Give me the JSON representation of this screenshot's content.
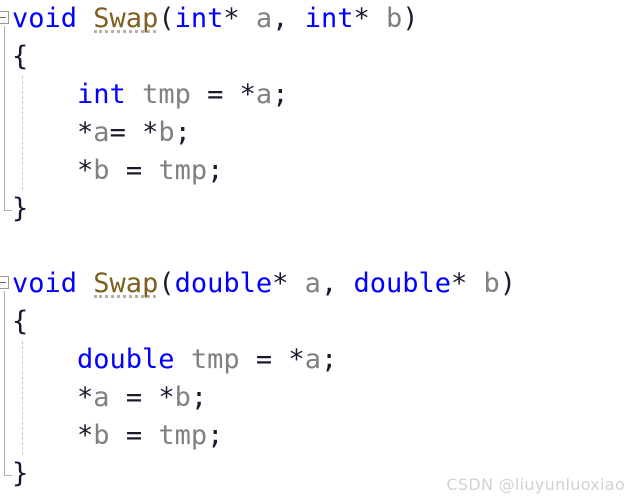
{
  "editor": {
    "background_color": "#ffffff",
    "font_size_px": 27,
    "line_height_px": 38,
    "language": "C",
    "colors": {
      "keyword": "#0000ff",
      "function_name": "#7d6020",
      "identifier": "#808080",
      "punctuation": "#1a1a2e",
      "brace": "#16163a",
      "fold_marker": "#9a9a9a",
      "indent_guide": "#c8c8c8",
      "watermark": "#d2d2d2"
    }
  },
  "blocks": [
    {
      "id": "swap-int",
      "fold_state": "expanded",
      "fold_glyph": "minus",
      "lines": [
        {
          "id": "line-1",
          "text": "void Swap(int* a, int* b)",
          "tokens": [
            {
              "t": "void",
              "k": "keyword"
            },
            {
              "t": " ",
              "k": "plain"
            },
            {
              "t": "Swap",
              "k": "function"
            },
            {
              "t": "(",
              "k": "punct"
            },
            {
              "t": "int",
              "k": "keyword"
            },
            {
              "t": "*",
              "k": "op"
            },
            {
              "t": " ",
              "k": "plain"
            },
            {
              "t": "a",
              "k": "ident"
            },
            {
              "t": ", ",
              "k": "punct"
            },
            {
              "t": "int",
              "k": "keyword"
            },
            {
              "t": "*",
              "k": "op"
            },
            {
              "t": " ",
              "k": "plain"
            },
            {
              "t": "b",
              "k": "ident"
            },
            {
              "t": ")",
              "k": "punct"
            }
          ]
        },
        {
          "id": "line-2",
          "text": "{",
          "tokens": [
            {
              "t": "{",
              "k": "brace"
            }
          ]
        },
        {
          "id": "line-3",
          "text": "    int tmp = *a;",
          "tokens": [
            {
              "t": "    ",
              "k": "plain"
            },
            {
              "t": "int",
              "k": "keyword"
            },
            {
              "t": " ",
              "k": "plain"
            },
            {
              "t": "tmp",
              "k": "ident"
            },
            {
              "t": " ",
              "k": "plain"
            },
            {
              "t": "=",
              "k": "op"
            },
            {
              "t": " ",
              "k": "plain"
            },
            {
              "t": "*",
              "k": "op"
            },
            {
              "t": "a",
              "k": "ident"
            },
            {
              "t": ";",
              "k": "punct"
            }
          ]
        },
        {
          "id": "line-4",
          "text": "    *a= *b;",
          "tokens": [
            {
              "t": "    ",
              "k": "plain"
            },
            {
              "t": "*",
              "k": "op"
            },
            {
              "t": "a",
              "k": "ident"
            },
            {
              "t": "=",
              "k": "op"
            },
            {
              "t": " ",
              "k": "plain"
            },
            {
              "t": "*",
              "k": "op"
            },
            {
              "t": "b",
              "k": "ident"
            },
            {
              "t": ";",
              "k": "punct"
            }
          ]
        },
        {
          "id": "line-5",
          "text": "    *b = tmp;",
          "tokens": [
            {
              "t": "    ",
              "k": "plain"
            },
            {
              "t": "*",
              "k": "op"
            },
            {
              "t": "b",
              "k": "ident"
            },
            {
              "t": " ",
              "k": "plain"
            },
            {
              "t": "=",
              "k": "op"
            },
            {
              "t": " ",
              "k": "plain"
            },
            {
              "t": "tmp",
              "k": "ident"
            },
            {
              "t": ";",
              "k": "punct"
            }
          ]
        },
        {
          "id": "line-6",
          "text": "}",
          "tokens": [
            {
              "t": "}",
              "k": "brace"
            }
          ]
        }
      ]
    },
    {
      "id": "swap-double",
      "fold_state": "expanded",
      "fold_glyph": "minus",
      "lines": [
        {
          "id": "line-7",
          "text": "void Swap(double* a, double* b)",
          "tokens": [
            {
              "t": "void",
              "k": "keyword"
            },
            {
              "t": " ",
              "k": "plain"
            },
            {
              "t": "Swap",
              "k": "function"
            },
            {
              "t": "(",
              "k": "punct"
            },
            {
              "t": "double",
              "k": "keyword"
            },
            {
              "t": "*",
              "k": "op"
            },
            {
              "t": " ",
              "k": "plain"
            },
            {
              "t": "a",
              "k": "ident"
            },
            {
              "t": ", ",
              "k": "punct"
            },
            {
              "t": "double",
              "k": "keyword"
            },
            {
              "t": "*",
              "k": "op"
            },
            {
              "t": " ",
              "k": "plain"
            },
            {
              "t": "b",
              "k": "ident"
            },
            {
              "t": ")",
              "k": "punct"
            }
          ]
        },
        {
          "id": "line-8",
          "text": "{",
          "tokens": [
            {
              "t": "{",
              "k": "brace"
            }
          ]
        },
        {
          "id": "line-9",
          "text": "    double tmp = *a;",
          "tokens": [
            {
              "t": "    ",
              "k": "plain"
            },
            {
              "t": "double",
              "k": "keyword"
            },
            {
              "t": " ",
              "k": "plain"
            },
            {
              "t": "tmp",
              "k": "ident"
            },
            {
              "t": " ",
              "k": "plain"
            },
            {
              "t": "=",
              "k": "op"
            },
            {
              "t": " ",
              "k": "plain"
            },
            {
              "t": "*",
              "k": "op"
            },
            {
              "t": "a",
              "k": "ident"
            },
            {
              "t": ";",
              "k": "punct"
            }
          ]
        },
        {
          "id": "line-10",
          "text": "    *a = *b;",
          "tokens": [
            {
              "t": "    ",
              "k": "plain"
            },
            {
              "t": "*",
              "k": "op"
            },
            {
              "t": "a",
              "k": "ident"
            },
            {
              "t": " ",
              "k": "plain"
            },
            {
              "t": "=",
              "k": "op"
            },
            {
              "t": " ",
              "k": "plain"
            },
            {
              "t": "*",
              "k": "op"
            },
            {
              "t": "b",
              "k": "ident"
            },
            {
              "t": ";",
              "k": "punct"
            }
          ]
        },
        {
          "id": "line-11",
          "text": "    *b = tmp;",
          "tokens": [
            {
              "t": "    ",
              "k": "plain"
            },
            {
              "t": "*",
              "k": "op"
            },
            {
              "t": "b",
              "k": "ident"
            },
            {
              "t": " ",
              "k": "plain"
            },
            {
              "t": "=",
              "k": "op"
            },
            {
              "t": " ",
              "k": "plain"
            },
            {
              "t": "tmp",
              "k": "ident"
            },
            {
              "t": ";",
              "k": "punct"
            }
          ]
        },
        {
          "id": "line-12",
          "text": "}",
          "tokens": [
            {
              "t": "}",
              "k": "brace"
            }
          ]
        }
      ]
    }
  ],
  "watermark": {
    "text": "CSDN @liuyunluoxiao"
  }
}
